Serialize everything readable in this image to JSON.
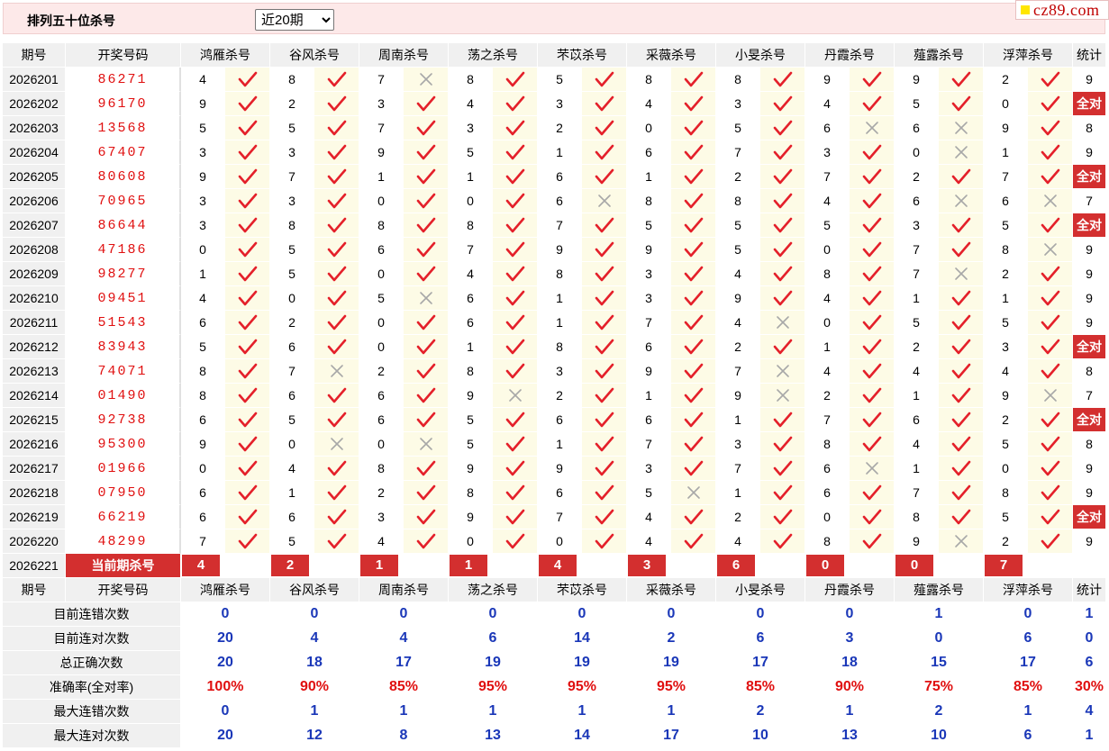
{
  "page": {
    "title": "排列五十位杀号",
    "period_select": "近20期",
    "period_options": [
      "近20期"
    ],
    "logo": "cz89.com"
  },
  "colors": {
    "accent_red": "#d32f2f",
    "number_red": "#e01010",
    "stat_blue": "#1a37b8",
    "mark_cell_bg": "#fdfbe6",
    "header_bg": "#f0f0f0",
    "topbar_bg": "#fde9e9"
  },
  "icons": {
    "hit": "check-icon",
    "miss": "cross-icon"
  },
  "header": {
    "issue": "期号",
    "number": "开奖号码",
    "total": "统计"
  },
  "experts": [
    "鸿雁杀号",
    "谷风杀号",
    "周南杀号",
    "荡之杀号",
    "芣苡杀号",
    "采薇杀号",
    "小旻杀号",
    "丹霞杀号",
    "薤露杀号",
    "浮萍杀号"
  ],
  "rows": [
    {
      "issue": "2026201",
      "num": "86271",
      "kills": [
        "4",
        "8",
        "7",
        "8",
        "5",
        "8",
        "8",
        "9",
        "9",
        "2"
      ],
      "marks": [
        1,
        1,
        0,
        1,
        1,
        1,
        1,
        1,
        1,
        1
      ],
      "total": "9"
    },
    {
      "issue": "2026202",
      "num": "96170",
      "kills": [
        "9",
        "2",
        "3",
        "4",
        "3",
        "4",
        "3",
        "4",
        "5",
        "0"
      ],
      "marks": [
        1,
        1,
        1,
        1,
        1,
        1,
        1,
        1,
        1,
        1
      ],
      "total": "全对"
    },
    {
      "issue": "2026203",
      "num": "13568",
      "kills": [
        "5",
        "5",
        "7",
        "3",
        "2",
        "0",
        "5",
        "6",
        "6",
        "9"
      ],
      "marks": [
        1,
        1,
        1,
        1,
        1,
        1,
        1,
        0,
        0,
        1
      ],
      "total": "8"
    },
    {
      "issue": "2026204",
      "num": "67407",
      "kills": [
        "3",
        "3",
        "9",
        "5",
        "1",
        "6",
        "7",
        "3",
        "0",
        "1"
      ],
      "marks": [
        1,
        1,
        1,
        1,
        1,
        1,
        1,
        1,
        0,
        1
      ],
      "total": "9"
    },
    {
      "issue": "2026205",
      "num": "80608",
      "kills": [
        "9",
        "7",
        "1",
        "1",
        "6",
        "1",
        "2",
        "7",
        "2",
        "7"
      ],
      "marks": [
        1,
        1,
        1,
        1,
        1,
        1,
        1,
        1,
        1,
        1
      ],
      "total": "全对"
    },
    {
      "issue": "2026206",
      "num": "70965",
      "kills": [
        "3",
        "3",
        "0",
        "0",
        "6",
        "8",
        "8",
        "4",
        "6",
        "6"
      ],
      "marks": [
        1,
        1,
        1,
        1,
        0,
        1,
        1,
        1,
        0,
        0
      ],
      "total": "7"
    },
    {
      "issue": "2026207",
      "num": "86644",
      "kills": [
        "3",
        "8",
        "8",
        "8",
        "7",
        "5",
        "5",
        "5",
        "3",
        "5"
      ],
      "marks": [
        1,
        1,
        1,
        1,
        1,
        1,
        1,
        1,
        1,
        1
      ],
      "total": "全对"
    },
    {
      "issue": "2026208",
      "num": "47186",
      "kills": [
        "0",
        "5",
        "6",
        "7",
        "9",
        "9",
        "5",
        "0",
        "7",
        "8"
      ],
      "marks": [
        1,
        1,
        1,
        1,
        1,
        1,
        1,
        1,
        1,
        0
      ],
      "total": "9"
    },
    {
      "issue": "2026209",
      "num": "98277",
      "kills": [
        "1",
        "5",
        "0",
        "4",
        "8",
        "3",
        "4",
        "8",
        "7",
        "2"
      ],
      "marks": [
        1,
        1,
        1,
        1,
        1,
        1,
        1,
        1,
        0,
        1
      ],
      "total": "9"
    },
    {
      "issue": "2026210",
      "num": "09451",
      "kills": [
        "4",
        "0",
        "5",
        "6",
        "1",
        "3",
        "9",
        "4",
        "1",
        "1"
      ],
      "marks": [
        1,
        1,
        0,
        1,
        1,
        1,
        1,
        1,
        1,
        1
      ],
      "total": "9"
    },
    {
      "issue": "2026211",
      "num": "51543",
      "kills": [
        "6",
        "2",
        "0",
        "6",
        "1",
        "7",
        "4",
        "0",
        "5",
        "5"
      ],
      "marks": [
        1,
        1,
        1,
        1,
        1,
        1,
        0,
        1,
        1,
        1
      ],
      "total": "9"
    },
    {
      "issue": "2026212",
      "num": "83943",
      "kills": [
        "5",
        "6",
        "0",
        "1",
        "8",
        "6",
        "2",
        "1",
        "2",
        "3"
      ],
      "marks": [
        1,
        1,
        1,
        1,
        1,
        1,
        1,
        1,
        1,
        1
      ],
      "total": "全对"
    },
    {
      "issue": "2026213",
      "num": "74071",
      "kills": [
        "8",
        "7",
        "2",
        "8",
        "3",
        "9",
        "7",
        "4",
        "4",
        "4"
      ],
      "marks": [
        1,
        0,
        1,
        1,
        1,
        1,
        0,
        1,
        1,
        1
      ],
      "total": "8"
    },
    {
      "issue": "2026214",
      "num": "01490",
      "kills": [
        "8",
        "6",
        "6",
        "9",
        "2",
        "1",
        "9",
        "2",
        "1",
        "9"
      ],
      "marks": [
        1,
        1,
        1,
        0,
        1,
        1,
        0,
        1,
        1,
        0
      ],
      "total": "7"
    },
    {
      "issue": "2026215",
      "num": "92738",
      "kills": [
        "6",
        "5",
        "6",
        "5",
        "6",
        "6",
        "1",
        "7",
        "6",
        "2"
      ],
      "marks": [
        1,
        1,
        1,
        1,
        1,
        1,
        1,
        1,
        1,
        1
      ],
      "total": "全对"
    },
    {
      "issue": "2026216",
      "num": "95300",
      "kills": [
        "9",
        "0",
        "0",
        "5",
        "1",
        "7",
        "3",
        "8",
        "4",
        "5"
      ],
      "marks": [
        1,
        0,
        0,
        1,
        1,
        1,
        1,
        1,
        1,
        1
      ],
      "total": "8"
    },
    {
      "issue": "2026217",
      "num": "01966",
      "kills": [
        "0",
        "4",
        "8",
        "9",
        "9",
        "3",
        "7",
        "6",
        "1",
        "0"
      ],
      "marks": [
        1,
        1,
        1,
        1,
        1,
        1,
        1,
        0,
        1,
        1
      ],
      "total": "9"
    },
    {
      "issue": "2026218",
      "num": "07950",
      "kills": [
        "6",
        "1",
        "2",
        "8",
        "6",
        "5",
        "1",
        "6",
        "7",
        "8"
      ],
      "marks": [
        1,
        1,
        1,
        1,
        1,
        0,
        1,
        1,
        1,
        1
      ],
      "total": "9"
    },
    {
      "issue": "2026219",
      "num": "66219",
      "kills": [
        "6",
        "6",
        "3",
        "9",
        "7",
        "4",
        "2",
        "0",
        "8",
        "5"
      ],
      "marks": [
        1,
        1,
        1,
        1,
        1,
        1,
        1,
        1,
        1,
        1
      ],
      "total": "全对"
    },
    {
      "issue": "2026220",
      "num": "48299",
      "kills": [
        "7",
        "5",
        "4",
        "0",
        "0",
        "4",
        "4",
        "8",
        "9",
        "2"
      ],
      "marks": [
        1,
        1,
        1,
        1,
        1,
        1,
        1,
        1,
        0,
        1
      ],
      "total": "9"
    }
  ],
  "current": {
    "issue": "2026221",
    "label": "当前期杀号",
    "kills": [
      "4",
      "2",
      "1",
      "1",
      "4",
      "3",
      "6",
      "0",
      "0",
      "7"
    ]
  },
  "stats": [
    {
      "label": "目前连错次数",
      "values": [
        "0",
        "0",
        "0",
        "0",
        "0",
        "0",
        "0",
        "0",
        "1",
        "0"
      ],
      "total": "1"
    },
    {
      "label": "目前连对次数",
      "values": [
        "20",
        "4",
        "4",
        "6",
        "14",
        "2",
        "6",
        "3",
        "0",
        "6"
      ],
      "total": "0"
    },
    {
      "label": "总正确次数",
      "values": [
        "20",
        "18",
        "17",
        "19",
        "19",
        "19",
        "17",
        "18",
        "15",
        "17"
      ],
      "total": "6"
    },
    {
      "label": "准确率(全对率)",
      "values": [
        "100%",
        "90%",
        "85%",
        "95%",
        "95%",
        "95%",
        "85%",
        "90%",
        "75%",
        "85%"
      ],
      "total": "30%",
      "red": true
    },
    {
      "label": "最大连错次数",
      "values": [
        "0",
        "1",
        "1",
        "1",
        "1",
        "1",
        "2",
        "1",
        "2",
        "1"
      ],
      "total": "4"
    },
    {
      "label": "最大连对次数",
      "values": [
        "20",
        "12",
        "8",
        "13",
        "14",
        "17",
        "10",
        "13",
        "10",
        "6"
      ],
      "total": "1"
    }
  ]
}
